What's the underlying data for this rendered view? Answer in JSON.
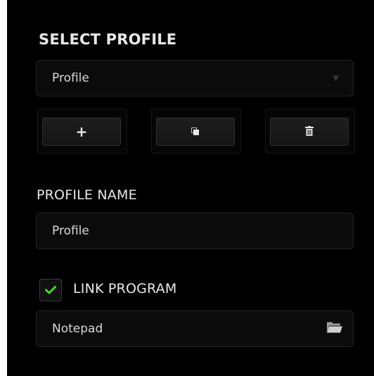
{
  "select_profile": {
    "heading": "SELECT PROFILE",
    "selected": "Profile",
    "caret_icon": "triangle-down-icon"
  },
  "profile_actions": {
    "add": {
      "icon": "plus-icon",
      "glyph": "+"
    },
    "copy": {
      "icon": "copy-icon"
    },
    "delete": {
      "icon": "trash-icon"
    }
  },
  "profile_name": {
    "heading": "PROFILE NAME",
    "value": "Profile"
  },
  "link_program": {
    "label": "LINK PROGRAM",
    "checked": true,
    "check_color": "#44d62c",
    "program": "Notepad",
    "browse_icon": "folder-icon"
  }
}
